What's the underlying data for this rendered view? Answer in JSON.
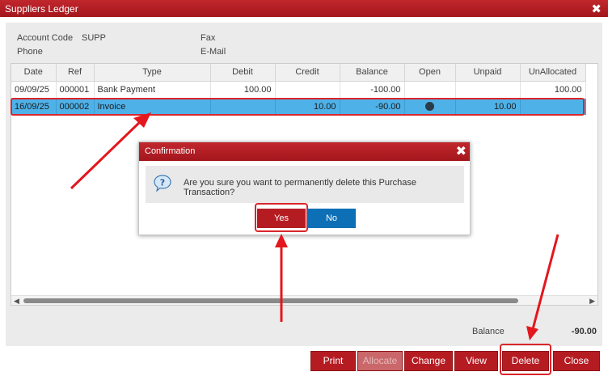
{
  "window": {
    "title": "Suppliers Ledger",
    "close_glyph": "✖"
  },
  "info": {
    "account_code_label": "Account Code",
    "account_code_value": "SUPP",
    "fax_label": "Fax",
    "phone_label": "Phone",
    "email_label": "E-Mail"
  },
  "grid": {
    "columns": [
      "Date",
      "Ref",
      "Type",
      "Debit",
      "Credit",
      "Balance",
      "Open",
      "Unpaid",
      "UnAllocated"
    ],
    "rows": [
      {
        "date": "09/09/25",
        "ref": "000001",
        "type": "Bank Payment",
        "debit": "100.00",
        "credit": "",
        "balance": "-100.00",
        "open": false,
        "unpaid": "",
        "unallocated": "100.00"
      },
      {
        "date": "16/09/25",
        "ref": "000002",
        "type": "Invoice",
        "debit": "",
        "credit": "10.00",
        "balance": "-90.00",
        "open": true,
        "unpaid": "10.00",
        "unallocated": ""
      }
    ],
    "selected_row": 1
  },
  "footer": {
    "balance_label": "Balance",
    "balance_value": "-90.00"
  },
  "buttons": {
    "print": "Print",
    "allocate": "Allocate",
    "change": "Change",
    "view": "View",
    "delete": "Delete",
    "close": "Close"
  },
  "dialog": {
    "title": "Confirmation",
    "message": "Are you sure you want to permanently delete this Purchase Transaction?",
    "yes": "Yes",
    "no": "No",
    "icon": "question-icon"
  },
  "colors": {
    "accent_red": "#b51c22",
    "selection_blue": "#4eb1e8",
    "no_button_blue": "#0d6fb6",
    "annotation_red": "#d9262b"
  }
}
